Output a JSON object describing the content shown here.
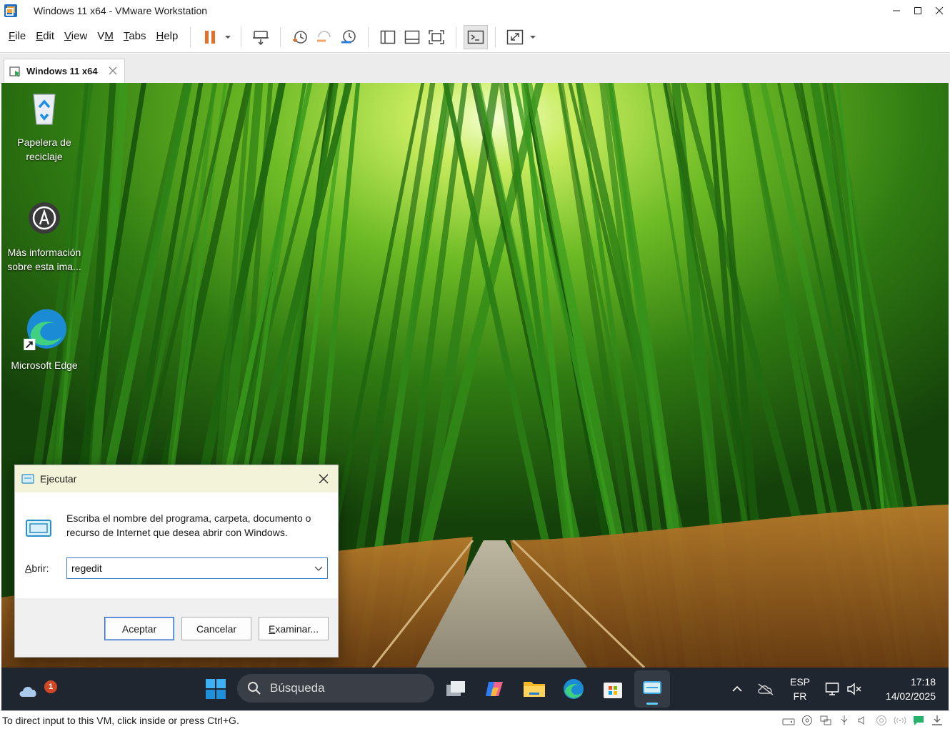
{
  "window": {
    "title": "Windows 11 x64 - VMware Workstation",
    "controls": [
      "minimize-icon",
      "maximize-icon",
      "close-icon"
    ]
  },
  "menu": [
    {
      "label": "File",
      "underline": "F"
    },
    {
      "label": "Edit",
      "underline": "E"
    },
    {
      "label": "View",
      "underline": "V"
    },
    {
      "label": "VM",
      "underline": "M"
    },
    {
      "label": "Tabs",
      "underline": "T"
    },
    {
      "label": "Help",
      "underline": "H"
    }
  ],
  "toolbar": {
    "icons": [
      "pause-icon",
      "dropdown-icon",
      "send-ctrl-alt-del-icon",
      "snapshot-take-icon",
      "snapshot-revert-icon",
      "snapshot-manager-icon",
      "library-view-icon",
      "thumbnail-view-icon",
      "fit-guest-icon",
      "console-view-icon",
      "fullscreen-icon",
      "dropdown-icon"
    ],
    "accent": "#e0702a"
  },
  "tab": {
    "label": "Windows 11 x64"
  },
  "desktop": {
    "icons": [
      {
        "label_line1": "Papelera de",
        "label_line2": "reciclaje",
        "icon": "recycle-bin-icon"
      },
      {
        "label_line1": "Más información",
        "label_line2": "sobre esta ima...",
        "icon": "spotlight-icon"
      },
      {
        "label_line1": "Microsoft Edge",
        "label_line2": "",
        "icon": "edge-icon"
      }
    ]
  },
  "run_dialog": {
    "title": "Ejecutar",
    "description": "Escriba el nombre del programa, carpeta, documento o recurso de Internet que desea abrir con Windows.",
    "open_label": "Abrir:",
    "open_label_underline": "A",
    "open_value": "regedit",
    "buttons": {
      "ok": "Aceptar",
      "cancel": "Cancelar",
      "browse": "Examinar..."
    },
    "browse_underline": "E"
  },
  "taskbar": {
    "weather_badge": "1",
    "search_placeholder": "Búsqueda",
    "apps": [
      "start-icon",
      "task-view-icon",
      "copilot-icon",
      "file-explorer-icon",
      "edge-icon",
      "store-icon",
      "run-app-icon"
    ],
    "language": {
      "line1": "ESP",
      "line2": "FR"
    },
    "time": "17:18",
    "date": "14/02/2025",
    "background": "#1f2630"
  },
  "statusbar": {
    "message": "To direct input to this VM, click inside or press Ctrl+G."
  }
}
